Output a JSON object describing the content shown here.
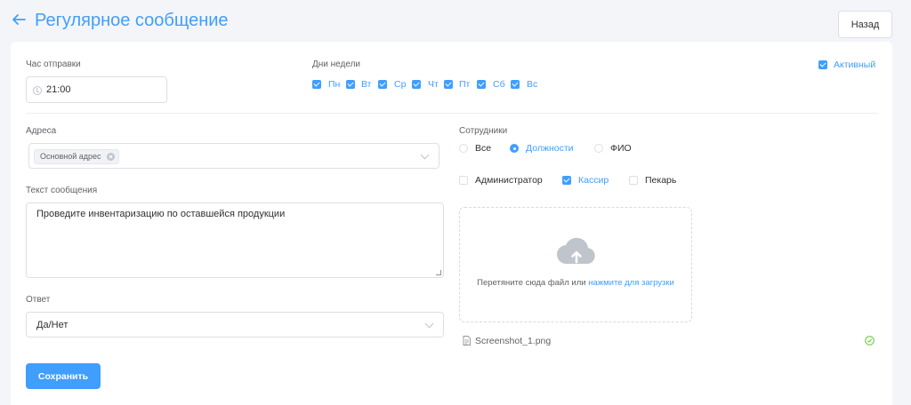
{
  "header": {
    "title": "Регулярное сообщение",
    "back_label": "Назад"
  },
  "form": {
    "send_hour": {
      "label": "Час отправки",
      "value": "21:00"
    },
    "weekdays": {
      "label": "Дни недели",
      "days": [
        {
          "label": "Пн",
          "checked": true
        },
        {
          "label": "Вт",
          "checked": true
        },
        {
          "label": "Ср",
          "checked": true
        },
        {
          "label": "Чт",
          "checked": true
        },
        {
          "label": "Пт",
          "checked": true
        },
        {
          "label": "Сб",
          "checked": true
        },
        {
          "label": "Вс",
          "checked": true
        }
      ]
    },
    "active": {
      "label": "Активный",
      "checked": true
    },
    "addresses": {
      "label": "Адреса",
      "tags": [
        "Основной адрес"
      ]
    },
    "message": {
      "label": "Текст сообщения",
      "value": "Проведите инвентаризацию по оставшейся продукции"
    },
    "answer": {
      "label": "Ответ",
      "value": "Да/Нет"
    },
    "employees": {
      "label": "Сотрудники",
      "modes": [
        {
          "label": "Все",
          "selected": false
        },
        {
          "label": "Должности",
          "selected": true
        },
        {
          "label": "ФИО",
          "selected": false
        }
      ],
      "positions": [
        {
          "label": "Администратор",
          "checked": false
        },
        {
          "label": "Кассир",
          "checked": true
        },
        {
          "label": "Пекарь",
          "checked": false
        }
      ]
    },
    "upload": {
      "text": "Перетяните сюда файл или",
      "link": "нажмите для загрузки"
    },
    "files": [
      {
        "name": "Screenshot_1.png"
      }
    ],
    "save_label": "Сохранить"
  },
  "colors": {
    "accent": "#409eff",
    "success": "#67c23a",
    "border": "#dcdfe6"
  }
}
